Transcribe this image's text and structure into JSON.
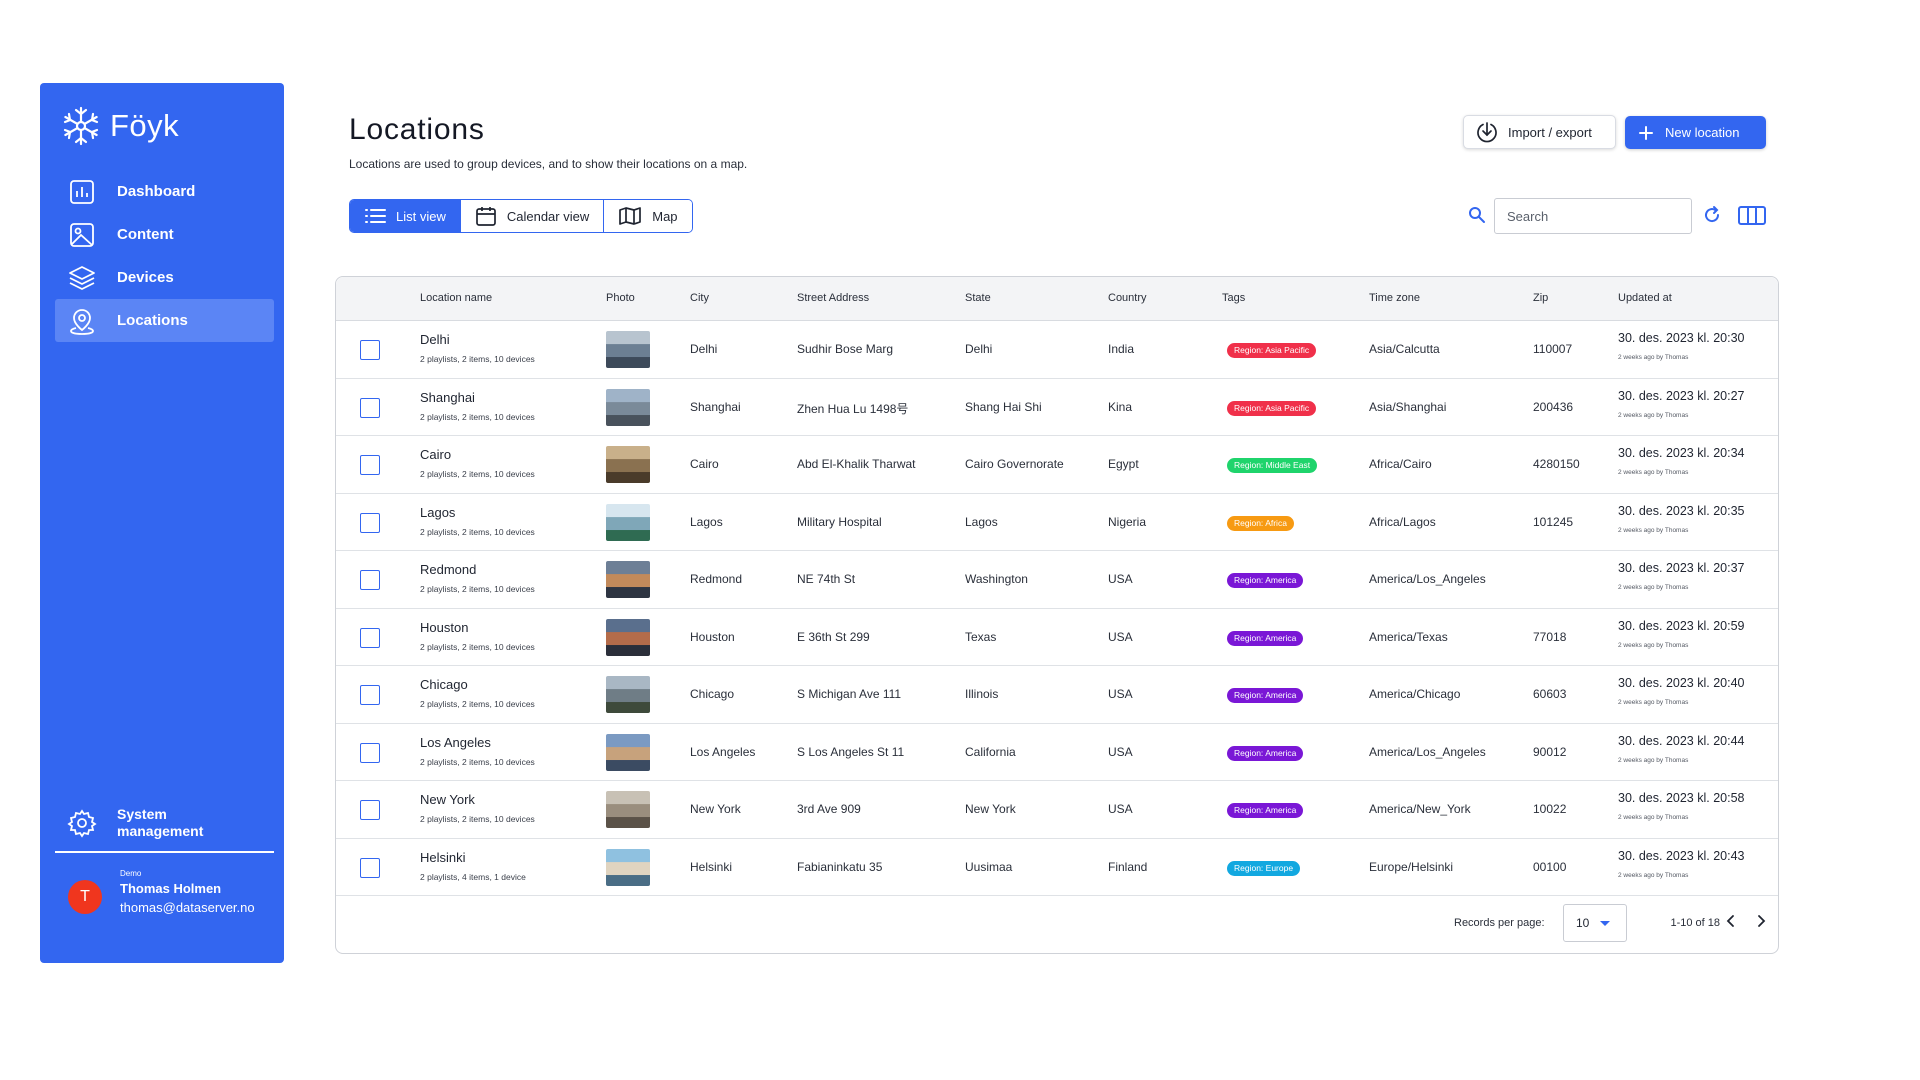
{
  "brand": {
    "name": "Föyk"
  },
  "sidebar": {
    "items": [
      {
        "label": "Dashboard",
        "icon": "dashboard-icon"
      },
      {
        "label": "Content",
        "icon": "image-icon"
      },
      {
        "label": "Devices",
        "icon": "layers-icon"
      },
      {
        "label": "Locations",
        "icon": "location-pin-icon",
        "active": true
      }
    ],
    "system": {
      "line1": "System",
      "line2": "management",
      "icon": "gear-icon"
    },
    "user": {
      "demo": "Demo",
      "initial": "T",
      "name": "Thomas Holmen",
      "email": "thomas@dataserver.no"
    }
  },
  "header": {
    "title": "Locations",
    "subtitle": "Locations are used to group devices, and to show their locations on a map.",
    "import_label": "Import / export",
    "new_label": "New location"
  },
  "views": [
    {
      "label": "List view",
      "icon": "list-icon",
      "active": true
    },
    {
      "label": "Calendar view",
      "icon": "calendar-icon"
    },
    {
      "label": "Map",
      "icon": "map-icon"
    }
  ],
  "search": {
    "placeholder": "Search",
    "value": ""
  },
  "table": {
    "columns": [
      "Location name",
      "Photo",
      "City",
      "Street Address",
      "State",
      "Country",
      "Tags",
      "Time zone",
      "Zip",
      "Updated at"
    ],
    "rows": [
      {
        "name": "Delhi",
        "sub": "2 playlists,  2 items,  10 devices",
        "city": "Delhi",
        "street": "Sudhir Bose Marg",
        "state": "Delhi",
        "country": "India",
        "tag": "Region: Asia Pacific",
        "tag_color": "#f0304a",
        "tz": "Asia/Calcutta",
        "zip": "110007",
        "updated": "30. des. 2023 kl. 20:30",
        "updated_sub": "2 weeks ago by Thomas"
      },
      {
        "name": "Shanghai",
        "sub": "2 playlists,  2 items,  10 devices",
        "city": "Shanghai",
        "street": "Zhen Hua Lu 1498号",
        "state": "Shang Hai Shi",
        "country": "Kina",
        "tag": "Region: Asia Pacific",
        "tag_color": "#f0304a",
        "tz": "Asia/Shanghai",
        "zip": "200436",
        "updated": "30. des. 2023 kl. 20:27",
        "updated_sub": "2 weeks ago by Thomas"
      },
      {
        "name": "Cairo",
        "sub": "2 playlists,  2 items,  10 devices",
        "city": "Cairo",
        "street": "Abd El-Khalik Tharwat",
        "state": "Cairo Governorate",
        "country": "Egypt",
        "tag": "Region: Middle East",
        "tag_color": "#1fd46c",
        "tz": "Africa/Cairo",
        "zip": "4280150",
        "updated": "30. des. 2023 kl. 20:34",
        "updated_sub": "2 weeks ago by Thomas"
      },
      {
        "name": "Lagos",
        "sub": "2 playlists,  2 items,  10 devices",
        "city": "Lagos",
        "street": "Military Hospital",
        "state": "Lagos",
        "country": "Nigeria",
        "tag": "Region: Africa",
        "tag_color": "#f79a12",
        "tz": "Africa/Lagos",
        "zip": "101245",
        "updated": "30. des. 2023 kl. 20:35",
        "updated_sub": "2 weeks ago by Thomas"
      },
      {
        "name": "Redmond",
        "sub": "2 playlists,  2 items,  10 devices",
        "city": "Redmond",
        "street": "NE 74th St",
        "state": "Washington",
        "country": "USA",
        "tag": "Region: America",
        "tag_color": "#7a17d6",
        "tz": "America/Los_Angeles",
        "zip": "",
        "updated": "30. des. 2023 kl. 20:37",
        "updated_sub": "2 weeks ago by Thomas"
      },
      {
        "name": "Houston",
        "sub": "2 playlists,  2 items,  10 devices",
        "city": "Houston",
        "street": "E 36th St 299",
        "state": "Texas",
        "country": "USA",
        "tag": "Region: America",
        "tag_color": "#7a17d6",
        "tz": "America/Texas",
        "zip": "77018",
        "updated": "30. des. 2023 kl. 20:59",
        "updated_sub": "2 weeks ago by Thomas"
      },
      {
        "name": "Chicago",
        "sub": "2 playlists,  2 items,  10 devices",
        "city": "Chicago",
        "street": "S Michigan Ave 111",
        "state": "Illinois",
        "country": "USA",
        "tag": "Region: America",
        "tag_color": "#7a17d6",
        "tz": "America/Chicago",
        "zip": "60603",
        "updated": "30. des. 2023 kl. 20:40",
        "updated_sub": "2 weeks ago by Thomas"
      },
      {
        "name": "Los Angeles",
        "sub": "2 playlists,  2 items,  10 devices",
        "city": "Los Angeles",
        "street": "S Los Angeles St 11",
        "state": "California",
        "country": "USA",
        "tag": "Region: America",
        "tag_color": "#7a17d6",
        "tz": "America/Los_Angeles",
        "zip": "90012",
        "updated": "30. des. 2023 kl. 20:44",
        "updated_sub": "2 weeks ago by Thomas"
      },
      {
        "name": "New York",
        "sub": "2 playlists,  2 items,  10 devices",
        "city": "New York",
        "street": "3rd Ave 909",
        "state": "New York",
        "country": "USA",
        "tag": "Region: America",
        "tag_color": "#7a17d6",
        "tz": "America/New_York",
        "zip": "10022",
        "updated": "30. des. 2023 kl. 20:58",
        "updated_sub": "2 weeks ago by Thomas"
      },
      {
        "name": "Helsinki",
        "sub": "2 playlists,  4 items,  1 device",
        "city": "Helsinki",
        "street": "Fabianinkatu 35",
        "state": "Uusimaa",
        "country": "Finland",
        "tag": "Region: Europe",
        "tag_color": "#12a8e0",
        "tz": "Europe/Helsinki",
        "zip": "00100",
        "updated": "30. des. 2023 kl. 20:43",
        "updated_sub": "2 weeks ago by Thomas"
      }
    ]
  },
  "pagination": {
    "records_label": "Records per page:",
    "per_page": "10",
    "range": "1-10 of 18"
  },
  "colors": {
    "accent": "#3366f0",
    "sidebar_active": "#5b85f5",
    "avatar": "#f0361e"
  }
}
